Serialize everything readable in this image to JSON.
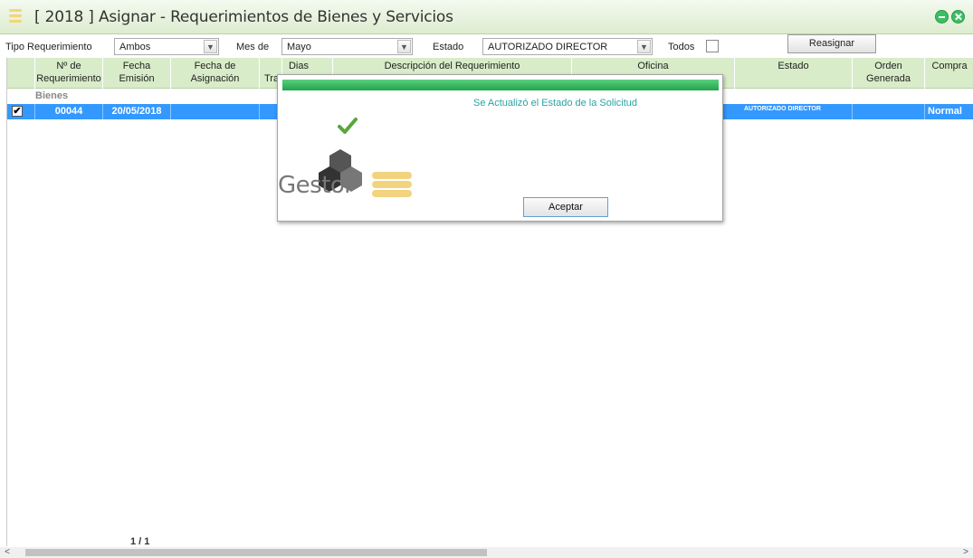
{
  "window": {
    "title": "[ 2018 ] Asignar - Requerimientos de Bienes y Servicios",
    "accent_color": "#3cbe62"
  },
  "filters": {
    "tipo_label": "Tipo Requerimiento",
    "tipo_value": "Ambos",
    "mes_label": "Mes de",
    "mes_value": "Mayo",
    "estado_label": "Estado",
    "estado_value": "AUTORIZADO DIRECTOR",
    "todos_label": "Todos",
    "reasignar_label": "Reasignar"
  },
  "grid": {
    "columns": [
      {
        "line1": "Nº de",
        "line2": "Requerimiento"
      },
      {
        "line1": "Fecha",
        "line2": "Emisión"
      },
      {
        "line1": "Fecha de",
        "line2": "Asignación"
      },
      {
        "line1": "Tra",
        "line2": ""
      },
      {
        "line1": "Dias",
        "line2": ""
      },
      {
        "line1": "Descripción del Requerimiento",
        "line2": ""
      },
      {
        "line1": "Oficina",
        "line2": ""
      },
      {
        "line1": "Estado",
        "line2": ""
      },
      {
        "line1": "Orden",
        "line2": "Generada"
      },
      {
        "line1": "Compra",
        "line2": ""
      }
    ],
    "group_label": "Bienes",
    "rows": [
      {
        "checked": "✔",
        "numero": "00044",
        "fecha_emision": "20/05/2018",
        "estado": "AUTORIZADO DIRECTOR",
        "compra": "Normal"
      }
    ],
    "pager": "1 / 1",
    "selected_row_color": "#3399ff"
  },
  "dialog": {
    "message": "Se Actualizó el Estado de la Solicitud",
    "logo_text": "Gestor",
    "accept_label": "Aceptar"
  }
}
